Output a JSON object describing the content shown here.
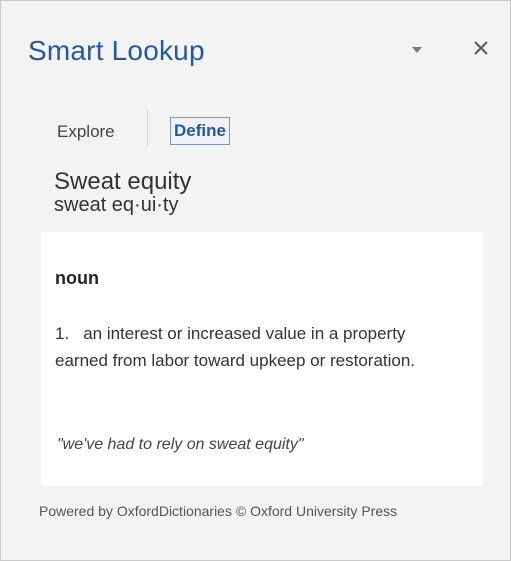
{
  "pane": {
    "title": "Smart Lookup",
    "dropdown_icon": "chevron-down-icon",
    "close_icon": "close-icon",
    "close_glyph": "✕"
  },
  "tabs": [
    {
      "label": "Explore",
      "selected": false
    },
    {
      "label": "Define",
      "selected": true
    }
  ],
  "entry": {
    "term": "Sweat equity",
    "pronunciation": "sweat eq·ui·ty",
    "part_of_speech": "noun",
    "definitions": [
      {
        "number": "1.",
        "text": "an interest or increased value in a property earned from labor toward upkeep or restoration.",
        "example": "\"we've had to rely on sweat equity\""
      }
    ]
  },
  "footer": {
    "attribution": "Powered by OxfordDictionaries © Oxford University Press"
  },
  "colors": {
    "accent": "#2b579a",
    "pane_bg": "#f3f3f3",
    "card_bg": "#ffffff"
  }
}
